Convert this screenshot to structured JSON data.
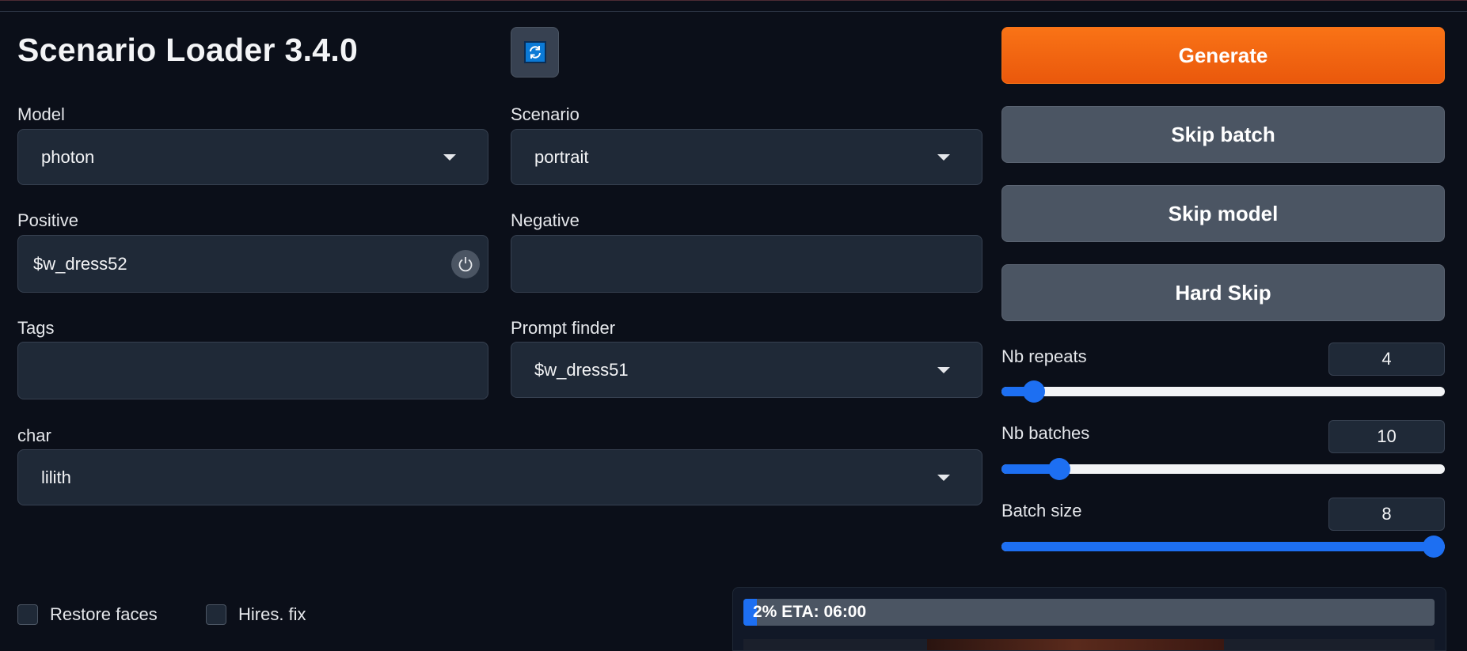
{
  "app": {
    "title": "Scenario Loader 3.4.0"
  },
  "fields": {
    "model": {
      "label": "Model",
      "value": "photon"
    },
    "scenario": {
      "label": "Scenario",
      "value": "portrait"
    },
    "positive": {
      "label": "Positive",
      "value": "$w_dress52"
    },
    "negative": {
      "label": "Negative",
      "value": ""
    },
    "tags": {
      "label": "Tags",
      "value": ""
    },
    "prompt_finder": {
      "label": "Prompt finder",
      "value": "$w_dress51"
    },
    "char": {
      "label": "char",
      "value": "lilith"
    }
  },
  "buttons": {
    "generate": "Generate",
    "skip_batch": "Skip batch",
    "skip_model": "Skip model",
    "hard_skip": "Hard Skip"
  },
  "sliders": {
    "nb_repeats": {
      "label": "Nb repeats",
      "value": "4",
      "fraction": 0.05
    },
    "nb_batches": {
      "label": "Nb batches",
      "value": "10",
      "fraction": 0.111
    },
    "batch_size": {
      "label": "Batch size",
      "value": "8",
      "fraction": 1.0
    }
  },
  "checkboxes": {
    "restore_faces": {
      "label": "Restore faces",
      "checked": false
    },
    "hires_fix": {
      "label": "Hires. fix",
      "checked": false
    }
  },
  "progress": {
    "text": "2% ETA: 06:00",
    "percent": 2
  },
  "icons": {
    "refresh": "refresh-icon",
    "power": "power-icon",
    "dropdown": "chevron-down-icon"
  },
  "colors": {
    "background": "#0b0f19",
    "primary": "#f97316",
    "accent": "#1d6ff2",
    "secondary_button": "#4b5563"
  }
}
